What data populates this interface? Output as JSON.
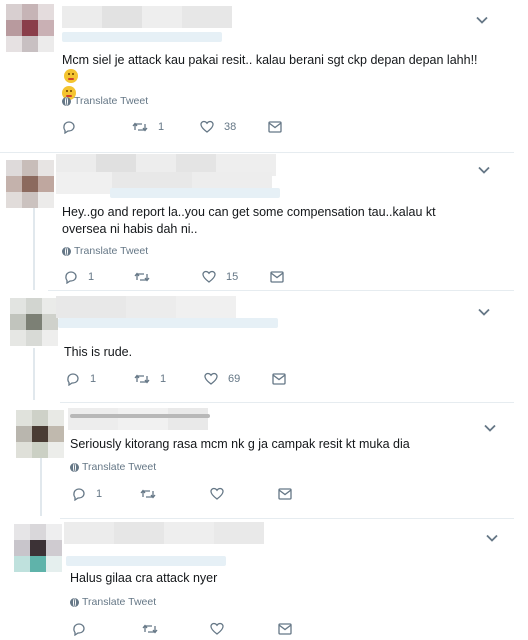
{
  "colors": {
    "icon": "#657786",
    "text": "#14171a",
    "divider": "#e6ecf0",
    "thread": "#e1e8ed"
  },
  "translate_label": "Translate Tweet",
  "tweets": [
    {
      "text": "Mcm siel je attack kau pakai resit.. kalau berani sgt ckp depan depan lahh!!",
      "emoji": [
        "angry-face-emoji",
        "angry-face-emoji"
      ],
      "reply_count": "",
      "retweet_count": "1",
      "like_count": "38",
      "author_redacted": true
    },
    {
      "text": "Hey..go and report la..you can get some compensation tau..kalau kt oversea ni habis dah ni..",
      "reply_count": "1",
      "retweet_count": "",
      "like_count": "15",
      "author_redacted": true
    },
    {
      "text": "This is rude.",
      "reply_count": "1",
      "retweet_count": "1",
      "like_count": "69",
      "author_redacted": true
    },
    {
      "text": "Seriously kitorang rasa mcm nk g ja campak resit kt muka dia",
      "reply_count": "1",
      "retweet_count": "",
      "like_count": "",
      "author_redacted": true
    },
    {
      "text": "Halus gilaa cra attack nyer",
      "reply_count": "",
      "retweet_count": "",
      "like_count": "",
      "author_redacted": true
    }
  ]
}
